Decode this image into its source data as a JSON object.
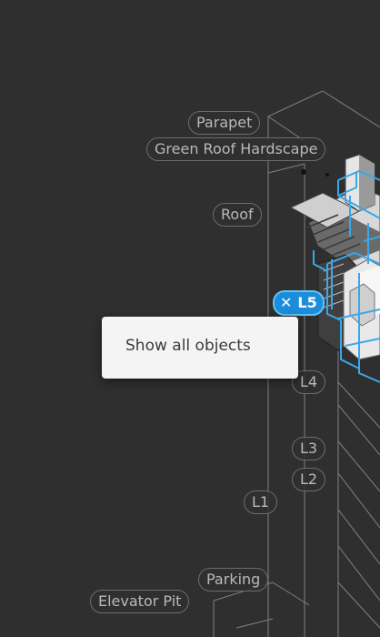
{
  "levels": [
    {
      "label": "Parapet"
    },
    {
      "label": "Green Roof Hardscape"
    },
    {
      "label": "Roof"
    },
    {
      "label": "L5",
      "active": true
    },
    {
      "label": "L4"
    },
    {
      "label": "L3"
    },
    {
      "label": "L2"
    },
    {
      "label": "L1"
    },
    {
      "label": "Parking"
    },
    {
      "label": "Elevator Pit"
    }
  ],
  "context_menu": {
    "items": [
      {
        "label": "Show all objects"
      }
    ]
  },
  "colors": {
    "background": "#2f2f2f",
    "selection_outline": "#3aa8e8",
    "active_level": "#1a8ddb",
    "model_light": "#e8e8e8",
    "model_dark": "#404040"
  },
  "icons": {
    "clear_level": "close-icon"
  }
}
